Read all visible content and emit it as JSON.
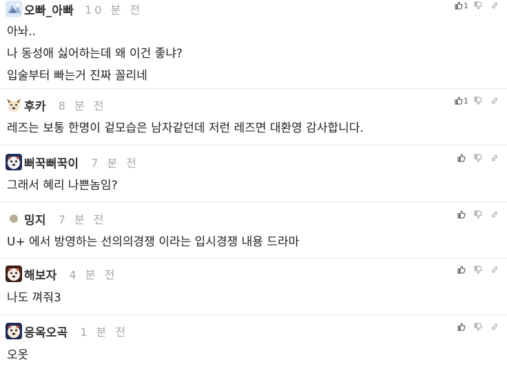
{
  "comments": [
    {
      "nick": "오빠_아빠",
      "time": "10 분 전",
      "lines": [
        "아놔..",
        "나 동성애 싫어하는데 왜 이건 좋냐?",
        "입술부터 빠는거 진짜 꼴리네"
      ],
      "likes": "1",
      "avatar": "ice-avatar"
    },
    {
      "nick": "후카",
      "time": "8 분 전",
      "lines": [
        "레즈는 보통 한명이 겉모습은 남자같던데 저런 레즈면 대환영 감사합니다."
      ],
      "likes": "1",
      "avatar": "dog-avatar"
    },
    {
      "nick": "뻐꾹뻐꾹이",
      "time": "7 분 전",
      "lines": [
        "그래서 혜리 나쁜놈임?"
      ],
      "likes": "",
      "avatar": "dog-avatar"
    },
    {
      "nick": "밍지",
      "time": "7 분 전",
      "lines": [
        "U+ 에서 방영하는 선의의경쟁 이라는 입시경쟁 내용 드라마"
      ],
      "likes": "",
      "avatar": "dot-avatar"
    },
    {
      "nick": "해보자",
      "time": "4 분 전",
      "lines": [
        "나도 껴줘3"
      ],
      "likes": "",
      "avatar": "dog-avatar"
    },
    {
      "nick": "응옥오곡",
      "time": "1 분 전",
      "lines": [
        "오옷"
      ],
      "likes": "",
      "avatar": "dog-avatar"
    }
  ],
  "icons": {
    "like": "thumbs-up-icon",
    "dislike": "thumbs-down-icon",
    "link": "link-icon"
  },
  "colors": {
    "nick": "#333333",
    "time": "#a6a6a6",
    "separator": "#e6e6e6"
  }
}
